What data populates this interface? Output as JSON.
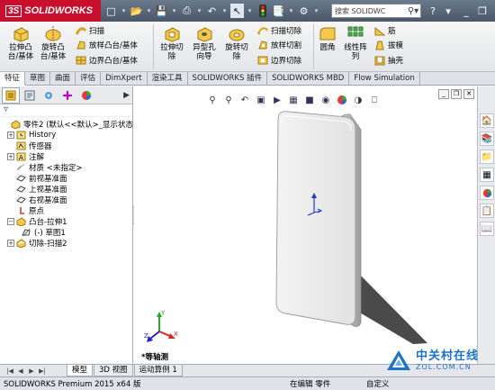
{
  "app": {
    "logo_prefix": "3S",
    "logo_text": "SOLIDWORKS"
  },
  "quick_access": {
    "search_placeholder": "搜索 SOLIDWC"
  },
  "ribbon": {
    "extrude_boss": "拉伸凸\n台/基体",
    "revolve_boss": "旋转凸\n台/基体",
    "sweep": "扫描",
    "loft_boss": "放样凸台/基体",
    "boundary_boss": "边界凸台/基体",
    "extrude_cut": "拉伸切\n除",
    "hole_wizard": "异型孔\n向导",
    "revolve_cut": "旋转切\n除",
    "sweep_cut": "扫描切除",
    "loft_cut": "放样切割",
    "boundary_cut": "边界切除",
    "fillet": "圆角",
    "linear_pattern": "线性阵\n列",
    "rib": "筋",
    "draft": "拔模",
    "shell": "抽壳"
  },
  "command_tabs": [
    "特征",
    "草图",
    "曲面",
    "评估",
    "DimXpert",
    "渲染工具",
    "SOLIDWORKS 插件",
    "SOLIDWORKS MBD",
    "Flow Simulation"
  ],
  "feature_tree": {
    "nodes": [
      {
        "label": "零件2 (默认<<默认>_显示状态",
        "expander": "",
        "icon": "part",
        "indent": 0
      },
      {
        "label": "History",
        "expander": "+",
        "icon": "history",
        "indent": 1
      },
      {
        "label": "传感器",
        "expander": "",
        "icon": "sensor",
        "indent": 1
      },
      {
        "label": "注解",
        "expander": "+",
        "icon": "annotation",
        "indent": 1
      },
      {
        "label": "材质 <未指定>",
        "expander": "",
        "icon": "material",
        "indent": 1
      },
      {
        "label": "前视基准面",
        "expander": "",
        "icon": "plane",
        "indent": 1
      },
      {
        "label": "上视基准面",
        "expander": "",
        "icon": "plane",
        "indent": 1
      },
      {
        "label": "右视基准面",
        "expander": "",
        "icon": "plane",
        "indent": 1
      },
      {
        "label": "原点",
        "expander": "",
        "icon": "origin",
        "indent": 1
      },
      {
        "label": "凸台-拉伸1",
        "expander": "−",
        "icon": "extrude",
        "indent": 1
      },
      {
        "label": "(-) 草图1",
        "expander": "",
        "icon": "sketch",
        "indent": 2
      },
      {
        "label": "切除-扫描2",
        "expander": "+",
        "icon": "cut",
        "indent": 1
      }
    ]
  },
  "viewport": {
    "view_label": "*等轴测"
  },
  "bottom_tabs": [
    "模型",
    "3D 视图",
    "运动算例 1"
  ],
  "status": {
    "product": "SOLIDWORKS Premium 2015 x64 版",
    "editing": "在编辑 零件",
    "units": "自定义"
  },
  "watermark": {
    "cn": "中关村在线",
    "url": "ZOL.COM.CN"
  },
  "colors": {
    "brand_red": "#c8102e",
    "body_gray": "#e8e8e8",
    "zol_blue": "#1d73c4"
  }
}
